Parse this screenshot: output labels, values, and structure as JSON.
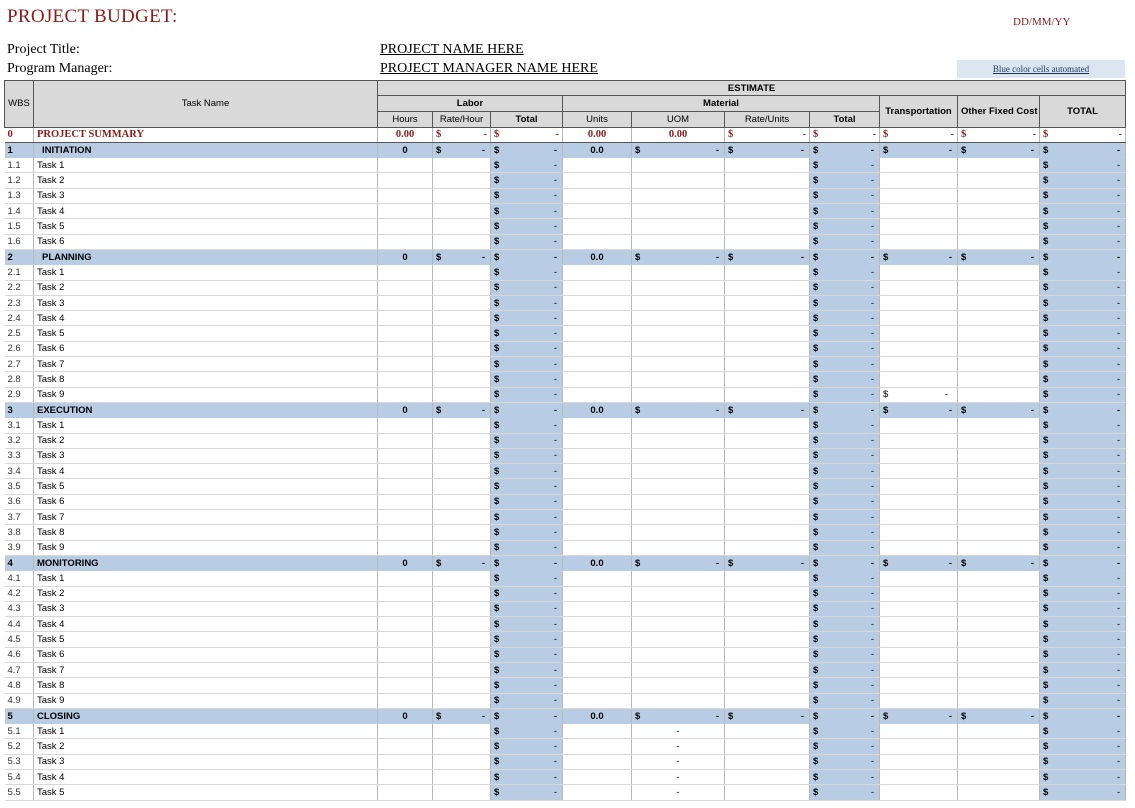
{
  "header": {
    "title": "PROJECT BUDGET:",
    "date": "DD/MM/YY",
    "project_title_label": "Project Title:",
    "project_title_value": "PROJECT NAME HERE",
    "program_manager_label": "Program Manager:",
    "program_manager_value": "PROJECT MANAGER NAME HERE",
    "note": "Blue color cells automated"
  },
  "columns": {
    "wbs": "WBS",
    "task_name": "Task Name",
    "estimate": "ESTIMATE",
    "labor": "Labor",
    "material": "Material",
    "hours": "Hours",
    "rate_hour": "Rate/Hour",
    "labor_total": "Total",
    "units": "Units",
    "uom": "UOM",
    "rate_units": "Rate/Units",
    "material_total": "Total",
    "transportation": "Transportation",
    "other_fixed_cost": "Other Fixed Cost",
    "total": "TOTAL"
  },
  "summary": {
    "wbs": "0",
    "name": "PROJECT SUMMARY",
    "hours": "0.00",
    "units": "0.00",
    "uom": "0.00",
    "currency": "$",
    "dash": "-"
  },
  "currency": "$",
  "dash": "-",
  "phases": [
    {
      "wbs": "1",
      "name": "INITIATION",
      "hours": "0",
      "units": "0.0",
      "tasks": [
        {
          "wbs": "1.1",
          "name": "Task 1"
        },
        {
          "wbs": "1.2",
          "name": "Task 2"
        },
        {
          "wbs": "1.3",
          "name": "Task 3"
        },
        {
          "wbs": "1.4",
          "name": "Task 4"
        },
        {
          "wbs": "1.5",
          "name": "Task 5"
        },
        {
          "wbs": "1.6",
          "name": "Task 6"
        }
      ]
    },
    {
      "wbs": "2",
      "name": "PLANNING",
      "hours": "0",
      "units": "0.0",
      "tasks": [
        {
          "wbs": "2.1",
          "name": "Task 1"
        },
        {
          "wbs": "2.2",
          "name": "Task 2"
        },
        {
          "wbs": "2.3",
          "name": "Task 3"
        },
        {
          "wbs": "2.4",
          "name": "Task 4"
        },
        {
          "wbs": "2.5",
          "name": "Task 5"
        },
        {
          "wbs": "2.6",
          "name": "Task 6"
        },
        {
          "wbs": "2.7",
          "name": "Task 7"
        },
        {
          "wbs": "2.8",
          "name": "Task 8"
        },
        {
          "wbs": "2.9",
          "name": "Task 9",
          "transport": true
        }
      ]
    },
    {
      "wbs": "3",
      "name": "EXECUTION",
      "hours": "0",
      "units": "0.0",
      "tasks": [
        {
          "wbs": "3.1",
          "name": "Task 1"
        },
        {
          "wbs": "3.2",
          "name": "Task 2"
        },
        {
          "wbs": "3.3",
          "name": "Task 3"
        },
        {
          "wbs": "3.4",
          "name": "Task 4"
        },
        {
          "wbs": "3.5",
          "name": "Task 5"
        },
        {
          "wbs": "3.6",
          "name": "Task 6"
        },
        {
          "wbs": "3.7",
          "name": "Task 7"
        },
        {
          "wbs": "3.8",
          "name": "Task 8"
        },
        {
          "wbs": "3.9",
          "name": "Task 9"
        }
      ]
    },
    {
      "wbs": "4",
      "name": "MONITORING",
      "hours": "0",
      "units": "0.0",
      "tasks": [
        {
          "wbs": "4.1",
          "name": "Task 1"
        },
        {
          "wbs": "4.2",
          "name": "Task 2"
        },
        {
          "wbs": "4.3",
          "name": "Task 3"
        },
        {
          "wbs": "4.4",
          "name": "Task 4"
        },
        {
          "wbs": "4.5",
          "name": "Task 5"
        },
        {
          "wbs": "4.6",
          "name": "Task 6"
        },
        {
          "wbs": "4.7",
          "name": "Task 7"
        },
        {
          "wbs": "4.8",
          "name": "Task 8"
        },
        {
          "wbs": "4.9",
          "name": "Task 9"
        }
      ]
    },
    {
      "wbs": "5",
      "name": "CLOSING",
      "hours": "0",
      "units": "0.0",
      "tasks": [
        {
          "wbs": "5.1",
          "name": "Task 1",
          "uom": "-"
        },
        {
          "wbs": "5.2",
          "name": "Task 2",
          "uom": "-"
        },
        {
          "wbs": "5.3",
          "name": "Task 3",
          "uom": "-"
        },
        {
          "wbs": "5.4",
          "name": "Task 4",
          "uom": "-"
        },
        {
          "wbs": "5.5",
          "name": "Task 5",
          "uom": "-"
        }
      ]
    }
  ]
}
